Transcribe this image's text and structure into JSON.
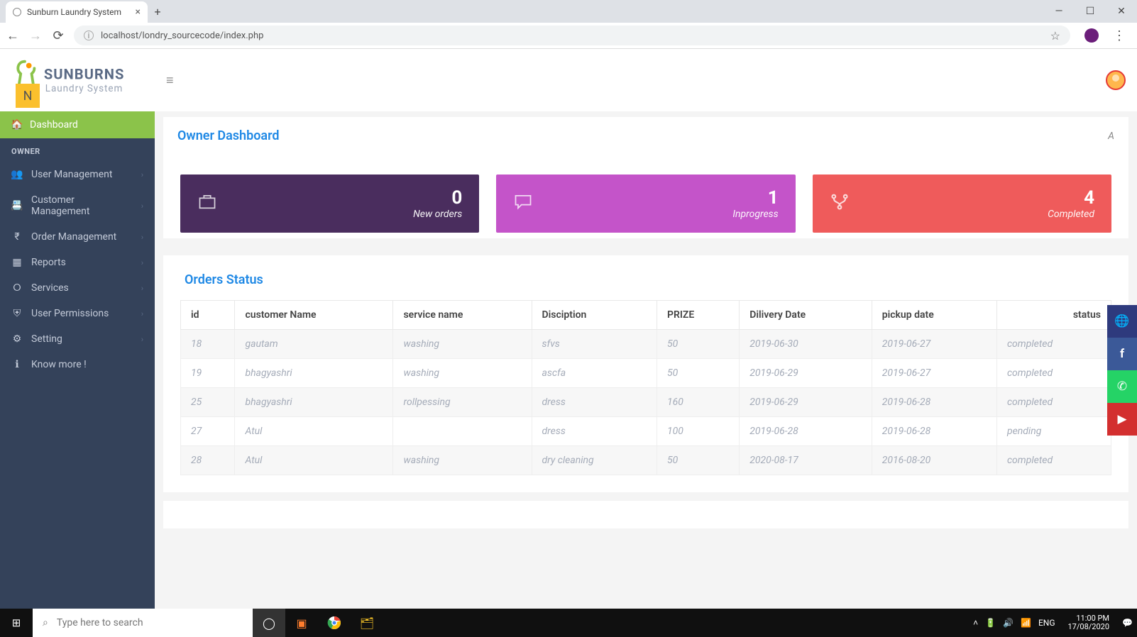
{
  "browser": {
    "tab_title": "Sunburn Laundry System",
    "url": "localhost/londry_sourcecode/index.php"
  },
  "brand": {
    "name": "SUNBURNS",
    "tagline": "Laundry System",
    "badge": "N"
  },
  "sidebar": {
    "active": "Dashboard",
    "section": "OWNER",
    "items": [
      {
        "label": "User Management",
        "icon": "user-plus"
      },
      {
        "label": "Customer Management",
        "icon": "id-card"
      },
      {
        "label": "Order Management",
        "icon": "rupee"
      },
      {
        "label": "Reports",
        "icon": "grid"
      },
      {
        "label": "Services",
        "icon": "circle"
      },
      {
        "label": "User Permissions",
        "icon": "shield"
      },
      {
        "label": "Setting",
        "icon": "gear"
      },
      {
        "label": "Know more !",
        "icon": "info"
      }
    ]
  },
  "page": {
    "title": "Owner Dashboard",
    "right_glyph": "A"
  },
  "cards": [
    {
      "value": "0",
      "label": "New orders",
      "color": "purple",
      "icon": "briefcase"
    },
    {
      "value": "1",
      "label": "Inprogress",
      "color": "pink",
      "icon": "chat"
    },
    {
      "value": "4",
      "label": "Completed",
      "color": "red",
      "icon": "branch"
    }
  ],
  "orders": {
    "title": "Orders Status",
    "columns": [
      "id",
      "customer Name",
      "service name",
      "Disciption",
      "PRIZE",
      "Dilivery Date",
      "pickup date",
      "status"
    ],
    "rows": [
      {
        "id": "18",
        "customer": "gautam",
        "service": "washing",
        "desc": "sfvs",
        "prize": "50",
        "delivery": "2019-06-30",
        "pickup": "2019-06-27",
        "status": "completed"
      },
      {
        "id": "19",
        "customer": "bhagyashri",
        "service": "washing",
        "desc": "ascfa",
        "prize": "50",
        "delivery": "2019-06-29",
        "pickup": "2019-06-27",
        "status": "completed"
      },
      {
        "id": "25",
        "customer": "bhagyashri",
        "service": "rollpessing",
        "desc": "dress",
        "prize": "160",
        "delivery": "2019-06-29",
        "pickup": "2019-06-28",
        "status": "completed"
      },
      {
        "id": "27",
        "customer": "Atul",
        "service": "",
        "desc": "dress",
        "prize": "100",
        "delivery": "2019-06-28",
        "pickup": "2019-06-28",
        "status": "pending"
      },
      {
        "id": "28",
        "customer": "Atul",
        "service": "washing",
        "desc": "dry cleaning",
        "prize": "50",
        "delivery": "2020-08-17",
        "pickup": "2016-08-20",
        "status": "completed"
      }
    ]
  },
  "taskbar": {
    "search_placeholder": "Type here to search",
    "lang": "ENG",
    "time": "11:00 PM",
    "date": "17/08/2020"
  }
}
